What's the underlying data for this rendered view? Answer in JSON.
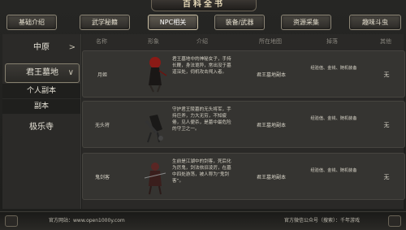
{
  "header": {
    "title": "百科全书"
  },
  "nav": {
    "tabs": [
      {
        "label": "基础介绍",
        "active": false
      },
      {
        "label": "武学秘籍",
        "active": false
      },
      {
        "label": "NPC相关",
        "active": true
      },
      {
        "label": "装备/武器",
        "active": false
      },
      {
        "label": "资源采集",
        "active": false
      },
      {
        "label": "趣味斗虫",
        "active": false
      }
    ]
  },
  "sidebar": {
    "items": [
      {
        "label": "中原"
      },
      {
        "label": "君王墓地"
      },
      {
        "label": "个人副本"
      },
      {
        "label": "副本"
      },
      {
        "label": "极乐寺"
      }
    ]
  },
  "table": {
    "columns": [
      "名称",
      "形象",
      "介绍",
      "所在地图",
      "掉落",
      "其他"
    ],
    "rows": [
      {
        "name": "月姬",
        "description": "君王墓地中的神秘女子，手持长鞭，身法诡异，常出没于墓道深处，伺机攻击闯入者。",
        "location": "君王墓地副本",
        "reward": "经验值、金钱、随机装备",
        "extra": "无"
      },
      {
        "name": "无头将",
        "description": "守护君王陵墓的无头将军，手持巨斧，力大无穷，不知疲倦，见人便杀，是墓中最危险的守卫之一。",
        "location": "君王墓地副本",
        "reward": "经验值、金钱、随机装备",
        "extra": "无"
      },
      {
        "name": "鬼剑客",
        "description": "生前是江湖中的剑客，死后化为厉鬼，剑法依旧凌厉，在墓中四处游荡，被人称为“鬼剑客”。",
        "location": "君王墓地副本",
        "reward": "经验值、金钱、随机装备",
        "extra": "无"
      }
    ]
  },
  "footer": {
    "website": "官方网站：www.open1000y.com",
    "wechat": "官方微信公众号（搜索）：千年游戏"
  },
  "colors": {
    "accent": "#c9bfa4",
    "background": "#1c1c1a"
  }
}
